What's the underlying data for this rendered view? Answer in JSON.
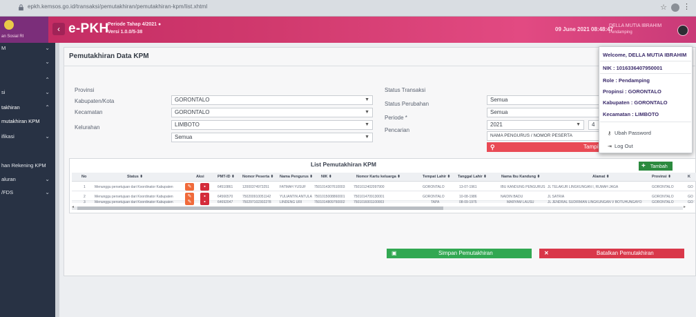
{
  "browser": {
    "url": "epkh.kemsos.go.id/transaksi/pemutakhiran/pemutakhiran-kpm/list.xhtml",
    "star_icon": "star-icon",
    "menu_icon": "kebab-icon"
  },
  "header": {
    "brand": "e-PKH",
    "period": "Periode Tahap 4/2021 ●",
    "version": "Versi 1.0.0/5-38",
    "date": "09 June 2021 08:48:47",
    "user_name": "DELLA MUTIA IBRAHIM",
    "user_role": "Pendamping",
    "side_label": "an Sosial RI"
  },
  "sidebar": {
    "items": [
      {
        "label": "M",
        "chevron": "⌄"
      },
      {
        "label": "",
        "chevron": "⌄"
      },
      {
        "label": "",
        "chevron": "⌃"
      },
      {
        "label": "si",
        "chevron": "⌄"
      },
      {
        "label": "takhiran",
        "chevron": "⌃"
      },
      {
        "label": "mutakhiran KPM",
        "chevron": ""
      },
      {
        "label": "ifikasi",
        "chevron": "⌄"
      },
      {
        "label": "han Rekening KPM",
        "chevron": ""
      },
      {
        "label": "aluran",
        "chevron": "⌄"
      },
      {
        "label": "/FDS",
        "chevron": "⌄"
      }
    ]
  },
  "panel": {
    "title": "Pemutakhiran Data KPM"
  },
  "filters": {
    "provinsi_label": "Provinsi",
    "provinsi_value": "GORONTALO",
    "kabkota_label": "Kabupaten/Kota",
    "kabkota_value": "GORONTALO",
    "kecamatan_label": "Kecamatan",
    "kecamatan_value": "LIMBOTO",
    "kelurahan_label": "Kelurahan",
    "kelurahan_value": "Semua",
    "status_transaksi_label": "Status Transaksi",
    "status_transaksi_value": "Semua",
    "status_perubahan_label": "Status Perubahan",
    "status_perubahan_value": "Semua",
    "periode_label": "Periode *",
    "periode_value": "2021",
    "periode_value2": "4",
    "pencarian_label": "Pencarian",
    "pencarian_placeholder": "NAMA PENGURUS / NOMOR PESERTA",
    "search_label": "Tampilkan"
  },
  "list": {
    "title": "List Pemutakhiran KPM",
    "add_label": "Tambah",
    "columns": [
      "No",
      "Status ⬍",
      "Aksi",
      "PMT-ID ⬍",
      "Nomor Peserta ⬍",
      "Nama Pengurus ⬍",
      "NIK ⬍",
      "Nomor Kartu keluarga ⬍",
      "Tempat Lahir ⬍",
      "Tanggal Lahir ⬍",
      "Nama Ibu Kandung ⬍",
      "Alamat ⬍",
      "Provinsi ⬍",
      "K"
    ],
    "rows": [
      {
        "no": "1",
        "status": "Menunggu persetujuan dari Koordinator Kabupaten",
        "pmt": "64510861",
        "peserta": "12000374973251",
        "nama": "FATMAH YUSUF",
        "nik": "7501014307610003",
        "kk": "7501012402097900",
        "tempat": "GORONTALO",
        "tgl": "13-07-1961",
        "ibu": "IBU KANDUNG PENGURUS",
        "alamat": "JL TELAKUR LINGKUNGAN I, RUMAH JAGA",
        "prov": "GORONTALO",
        "k": "GO"
      },
      {
        "no": "2",
        "status": "Menunggu persetujuan dari Koordinator Kabupaten",
        "pmt": "64566570",
        "peserta": "750200910051142",
        "nama": "YULIANTIN ANTULA",
        "nik": "7501015008860001",
        "kk": "7501014709130001",
        "tempat": "GORONTALO",
        "tgl": "10-08-1986",
        "ibu": "NAIDIN BADU",
        "alamat": "JL SATRIA",
        "prov": "GORONTALO",
        "k": "GO"
      },
      {
        "no": "3",
        "status": "Menunggu persetujuan dari Koordinator Kabupaten",
        "pmt": "64692047",
        "peserta": "750297102302278",
        "nama": "LINDENG URI",
        "nik": "7501014809750002",
        "kk": "7501016001100003",
        "tempat": "TAPA",
        "tgl": "08-09-1975",
        "ibu": "MARYAM LAUSU",
        "alamat": "JL JENDRAL SUDIRMAN LINGKUNGAN V BOTUHUNGAYO",
        "prov": "GORONTALO",
        "k": "GO"
      }
    ]
  },
  "actions": {
    "save_label": "Simpan Pemutakhiran",
    "cancel_label": "Batalkan Pemutakhiran"
  },
  "user_menu": {
    "welcome": "Welcome, DELLA MUTIA IBRAHIM",
    "nik": "NIK : 1016336407950001",
    "role": "Role : Pendamping",
    "provinsi": "Propinsi : GORONTALO",
    "kabupaten": "Kabupaten : GORONTALO",
    "kecamatan": "Kecamatan : LIMBOTO",
    "change_password": "Ubah Password",
    "logout": "Log Out"
  },
  "colors": {
    "topbar": "#d13a6e",
    "sidebar": "#283244",
    "search": "#e94a55",
    "save": "#32a852",
    "cancel": "#d9384a",
    "edit": "#f06a3a",
    "delete": "#d42a3a"
  }
}
